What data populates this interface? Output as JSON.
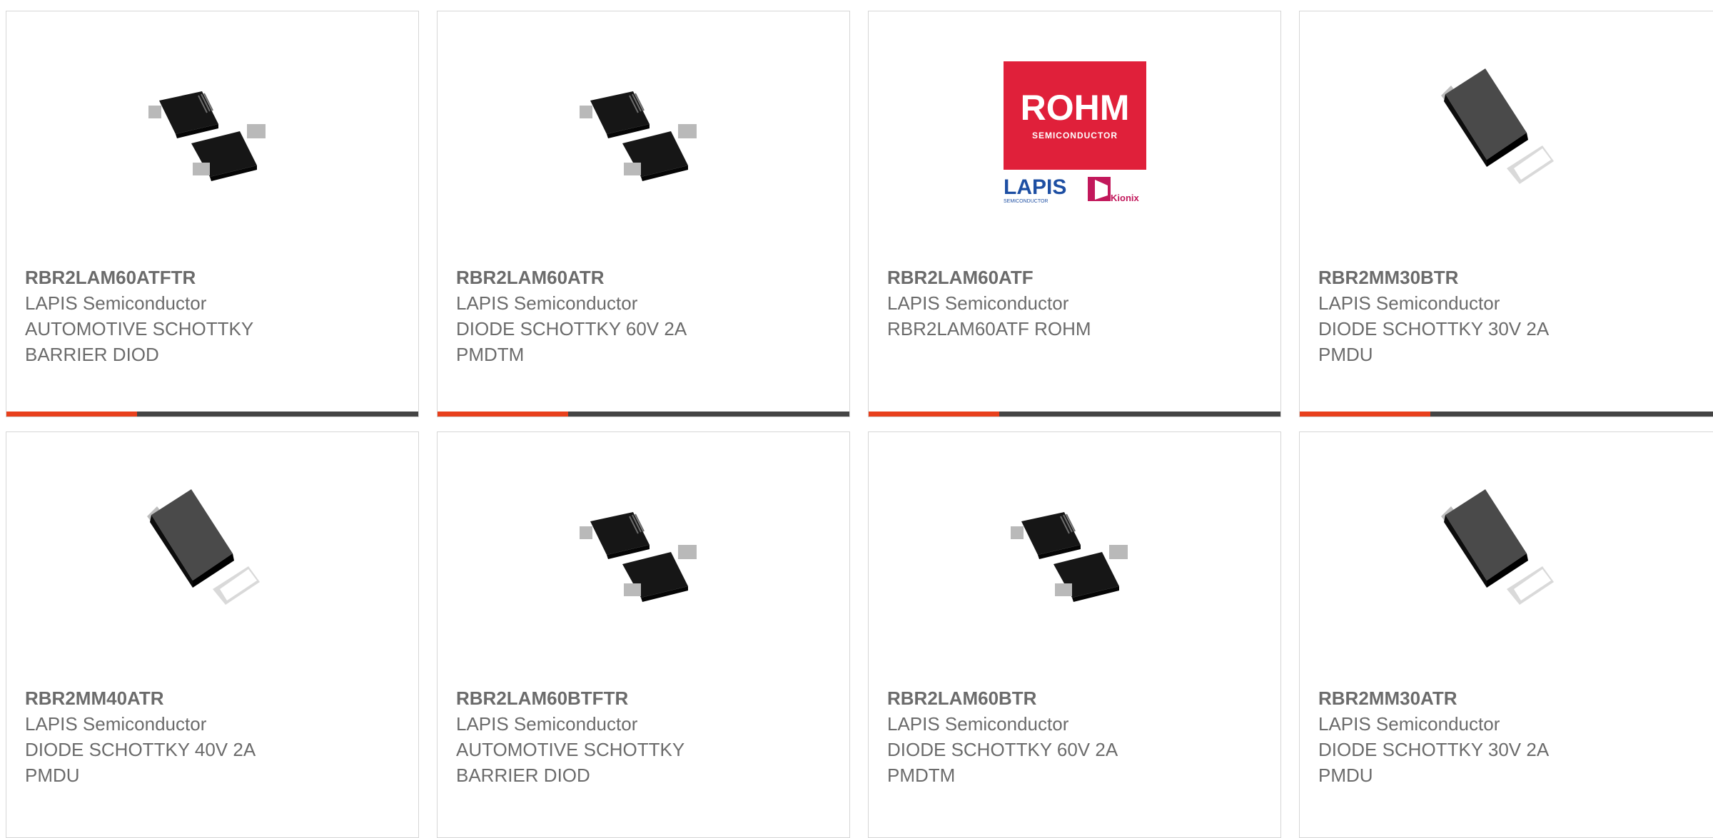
{
  "accent_color": "#e8401c",
  "cards": [
    {
      "part": "RBR2LAM60ATFTR",
      "manufacturer": "LAPIS Semiconductor",
      "description": "AUTOMOTIVE SCHOTTKY\nBARRIER DIOD",
      "image": "pmdtm-package-icon"
    },
    {
      "part": "RBR2LAM60ATR",
      "manufacturer": "LAPIS Semiconductor",
      "description": "DIODE SCHOTTKY 60V 2A\nPMDTM",
      "image": "pmdtm-package-icon"
    },
    {
      "part": "RBR2LAM60ATF",
      "manufacturer": "LAPIS Semiconductor",
      "description": "RBR2LAM60ATF ROHM",
      "image": "rohm-logo",
      "logo": {
        "rohm": "ROHM",
        "rohm_sub": "SEMICONDUCTOR",
        "lapis": "LAPIS",
        "lapis_sub": "SEMICONDUCTOR",
        "kionix": "Kionix"
      }
    },
    {
      "part": "RBR2MM30BTR",
      "manufacturer": "LAPIS Semiconductor",
      "description": "DIODE SCHOTTKY 30V 2A\nPMDU",
      "image": "pmdu-package-icon"
    },
    {
      "part": "RBR2MM40ATR",
      "manufacturer": "LAPIS Semiconductor",
      "description": "DIODE SCHOTTKY 40V 2A\nPMDU",
      "image": "pmdu-package-icon"
    },
    {
      "part": "RBR2LAM60BTFTR",
      "manufacturer": "LAPIS Semiconductor",
      "description": "AUTOMOTIVE SCHOTTKY\nBARRIER DIOD",
      "image": "pmdtm-package-icon"
    },
    {
      "part": "RBR2LAM60BTR",
      "manufacturer": "LAPIS Semiconductor",
      "description": "DIODE SCHOTTKY 60V 2A\nPMDTM",
      "image": "pmdtm-package-icon"
    },
    {
      "part": "RBR2MM30ATR",
      "manufacturer": "LAPIS Semiconductor",
      "description": "DIODE SCHOTTKY 30V 2A\nPMDU",
      "image": "pmdu-package-icon"
    }
  ]
}
